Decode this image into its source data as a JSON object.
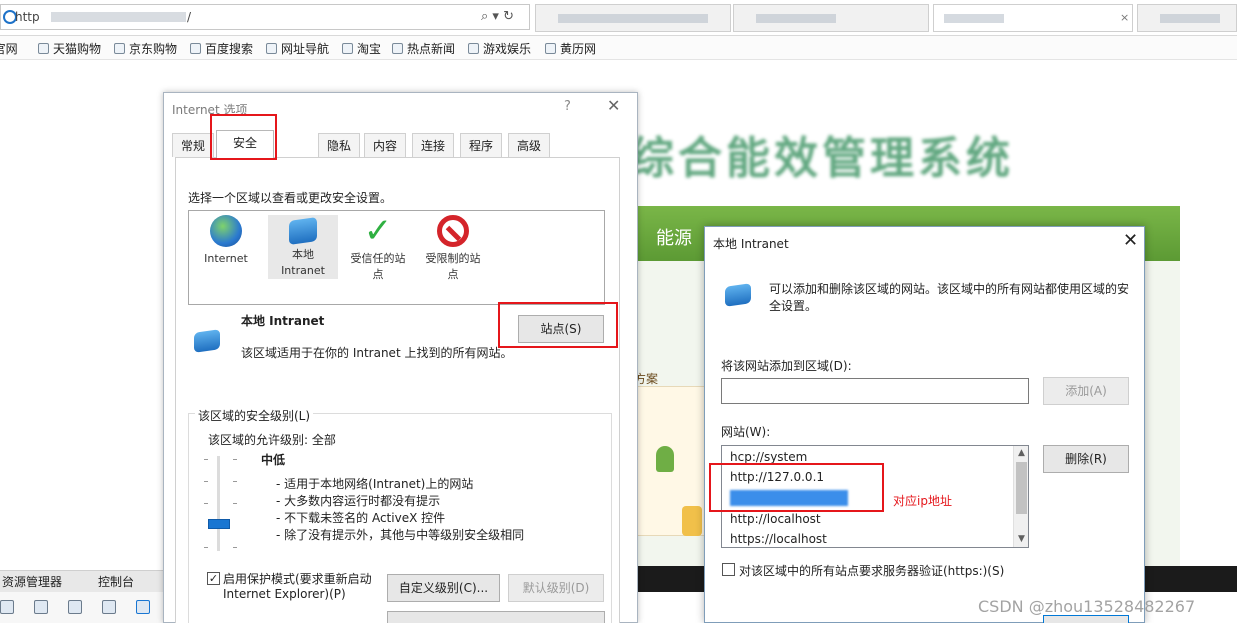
{
  "browser": {
    "url_prefix": "http",
    "url_suffix": "/",
    "search_refresh": "⌕ ▾ ↻",
    "tab_close": "×"
  },
  "favorites": [
    "  官网",
    "天猫购物",
    "京东购物",
    "百度搜索",
    "网址导航",
    "淘宝",
    "热点新闻",
    "游戏娱乐",
    "黄历网"
  ],
  "background": {
    "title": "综合能效管理系统",
    "panel_title": "能源",
    "panel_side": "方案"
  },
  "taskbar": {
    "left_label": "资源管理器",
    "right_label": "控制台"
  },
  "options_dialog": {
    "title": "Internet 选项",
    "help": "?",
    "close": "✕",
    "tabs": [
      "常规",
      "安全",
      "隐私",
      "内容",
      "连接",
      "程序",
      "高级"
    ],
    "prompt": "选择一个区域以查看或更改安全设置。",
    "zones": [
      {
        "label": "Internet",
        "icon": "globe-icon"
      },
      {
        "label": "本地\nIntranet",
        "icon": "intranet-icon"
      },
      {
        "label": "受信任的站\n点",
        "icon": "checkmark-icon"
      },
      {
        "label": "受限制的站\n点",
        "icon": "no-entry-icon"
      }
    ],
    "zone_name": "本地 Intranet",
    "zone_desc": "该区域适用于在你的 Intranet 上找到的所有网站。",
    "sites_button": "站点(S)",
    "security_group": "该区域的安全级别(L)",
    "allowed_levels": "该区域的允许级别: 全部",
    "level": "中低",
    "level_items": [
      "- 适用于本地网络(Intranet)上的网站",
      "- 大多数内容运行时都没有提示",
      "- 不下载未签名的 ActiveX 控件",
      "- 除了没有提示外，其他与中等级别安全级相同"
    ],
    "protected_mode": "启用保护模式(要求重新启动",
    "protected_mode2": "Internet Explorer)(P)",
    "custom_button": "自定义级别(C)...",
    "default_button": "默认级别(D)"
  },
  "intranet_dialog": {
    "title": "本地 Intranet",
    "close": "✕",
    "desc": "可以添加和删除该区域的网站。该区域中的所有网站都使用区域的安全设置。",
    "add_label": "将该网站添加到区域(D):",
    "add_value": "",
    "add_button": "添加(A)",
    "sites_label": "网站(W):",
    "sites": [
      "hcp://system",
      "http://127.0.0.1",
      "",
      "http://localhost",
      "https://localhost"
    ],
    "remove_button": "删除(R)",
    "require_https": "对该区域中的所有站点要求服务器验证(https:)(S)"
  },
  "annotation": "对应ip地址",
  "watermark": "CSDN @zhou13528482267",
  "colors": {
    "highlight": "#e5161b",
    "accent": "#1976d2"
  }
}
